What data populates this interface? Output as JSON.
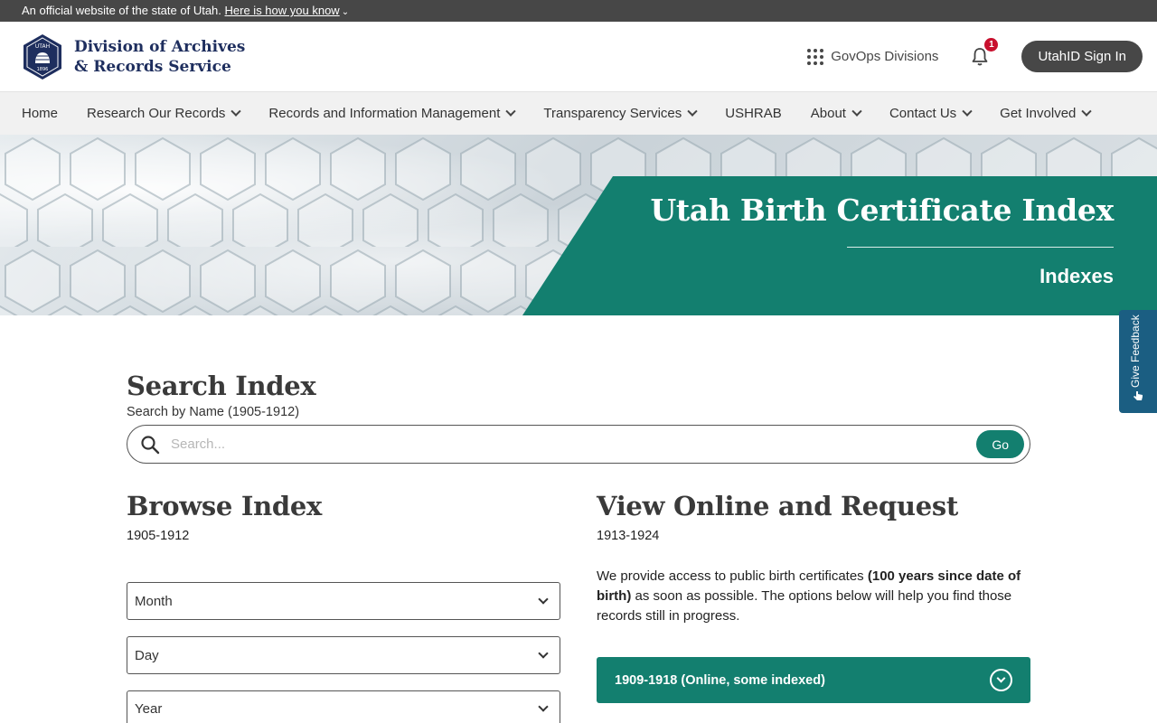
{
  "gov_banner": {
    "text": "An official website of the state of Utah.",
    "link": "Here is how you know"
  },
  "header": {
    "brand_line1": "Division of Archives",
    "brand_line2": "& Records Service",
    "seal_text_top": "UTAH",
    "seal_text_bottom": "1896",
    "govops_label": "GovOps Divisions",
    "notification_count": "1",
    "signin_label": "UtahID Sign In"
  },
  "nav": {
    "items": [
      {
        "label": "Home"
      },
      {
        "label": "Research Our Records"
      },
      {
        "label": "Records and Information Management"
      },
      {
        "label": "Transparency Services"
      },
      {
        "label": "USHRAB"
      },
      {
        "label": "About"
      },
      {
        "label": "Contact Us"
      },
      {
        "label": "Get Involved"
      }
    ]
  },
  "hero": {
    "title": "Utah Birth Certificate Index",
    "subtitle": "Indexes"
  },
  "feedback": {
    "label": "Give Feedback"
  },
  "search": {
    "heading": "Search Index",
    "label": "Search by Name (1905-1912)",
    "placeholder": "Search...",
    "button": "Go"
  },
  "browse": {
    "heading": "Browse Index",
    "dates": "1905-1912",
    "month": "Month",
    "day": "Day",
    "year": "Year"
  },
  "view": {
    "heading": "View Online and Request",
    "dates": "1913-1924",
    "para_before": "We provide access to public birth certificates ",
    "para_bold": "(100 years since date of birth)",
    "para_after": " as soon as possible. The options below will help you find those records still in progress.",
    "accordion_label": "1909-1918 (Online, some indexed)"
  },
  "colors": {
    "teal": "#137f6f",
    "navy": "#1e2e5e",
    "banner_gray": "#474747",
    "feedback_blue": "#1b5e82"
  }
}
